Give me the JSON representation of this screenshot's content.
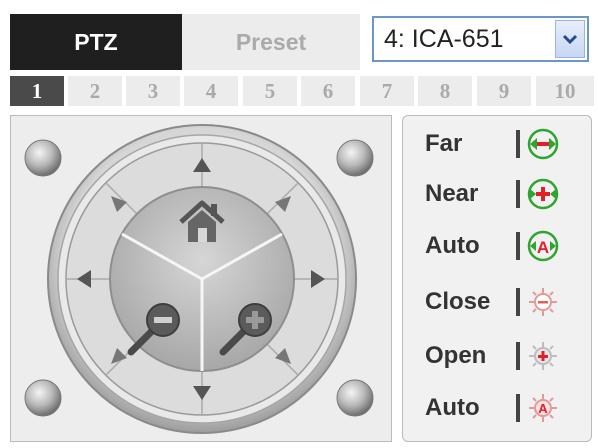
{
  "tabs": {
    "ptz_label": "PTZ",
    "preset_label": "Preset"
  },
  "camera_select": {
    "value": "4: ICA-651"
  },
  "channels": [
    "1",
    "2",
    "3",
    "4",
    "5",
    "6",
    "7",
    "8",
    "9",
    "10"
  ],
  "active_channel": "1",
  "focus": {
    "far": "Far",
    "near": "Near",
    "auto": "Auto"
  },
  "iris": {
    "close": "Close",
    "open": "Open",
    "auto": "Auto"
  },
  "colors": {
    "focus_green": "#2ea52e",
    "focus_red": "#e0202a",
    "dark_tab": "#1f1f1f",
    "select_border": "#6c96c8"
  }
}
